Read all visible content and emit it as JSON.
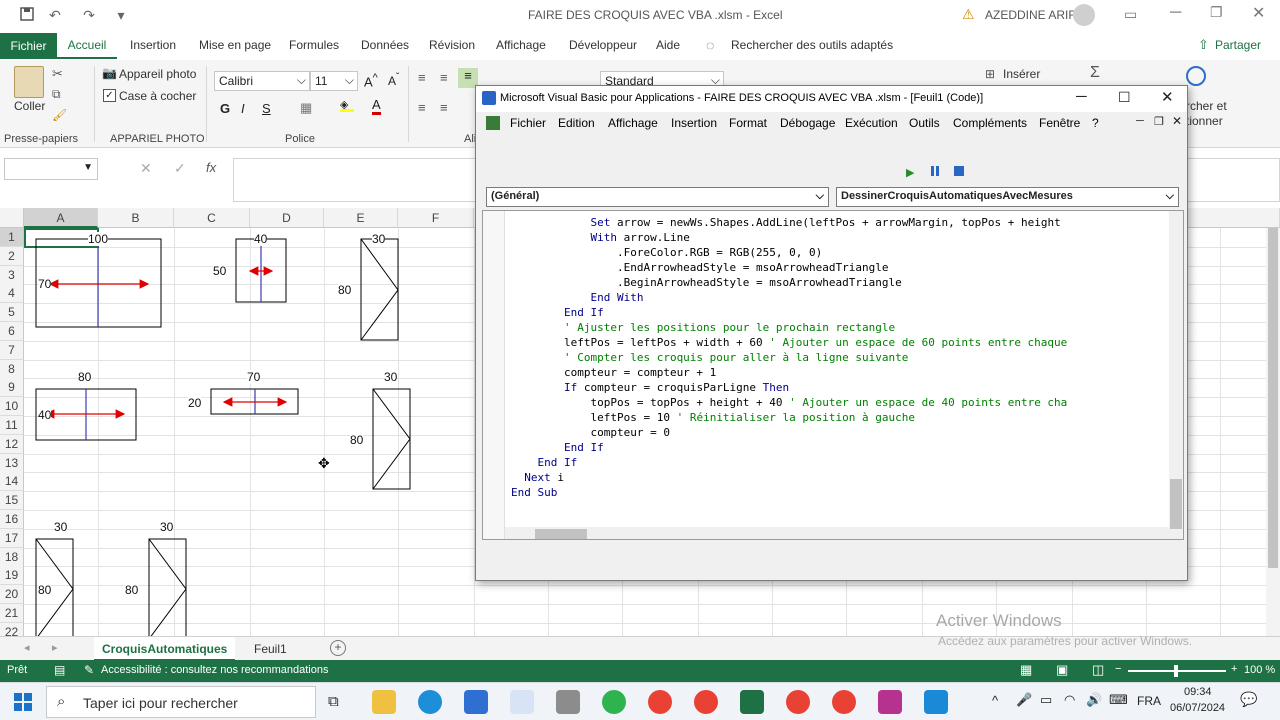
{
  "window": {
    "title": "FAIRE DES CROQUIS AVEC VBA .xlsm  -  Excel",
    "user": "AZEDDINE ARIF"
  },
  "tabs": [
    "Fichier",
    "Accueil",
    "Insertion",
    "Mise en page",
    "Formules",
    "Données",
    "Révision",
    "Affichage",
    "Développeur",
    "Aide"
  ],
  "search_tools": "Rechercher des outils adaptés",
  "share": "Partager",
  "ribbon": {
    "paste": "Coller",
    "clipboard_label": "Presse-papiers",
    "camera": "Appareil photo",
    "checkbox": "Case à cocher",
    "camera_group": "APPARIEL PHOTO",
    "font_name": "Calibri",
    "font_size": "11",
    "font_group": "Police",
    "align_group": "Ali",
    "number_format": "Standard",
    "insert": "Insérer",
    "find_line1": "rcher et",
    "find_line2": "tionner",
    "bold": "G",
    "italic": "I",
    "underline": "S"
  },
  "formula": {
    "fx": "fx"
  },
  "columns": [
    "A",
    "B",
    "C",
    "D",
    "E",
    "F"
  ],
  "rows": [
    "1",
    "2",
    "3",
    "4",
    "5",
    "6",
    "7",
    "8",
    "9",
    "10",
    "11",
    "12",
    "13",
    "14",
    "15",
    "16",
    "17",
    "18",
    "19",
    "20",
    "21",
    "22"
  ],
  "sketch_labels": {
    "r1_w": "100",
    "r1_h": "70",
    "r2_w": "40",
    "r2_h": "50",
    "r3_w": "30",
    "r3_h": "80",
    "r4_w": "80",
    "r4_h": "40",
    "r5_w": "70",
    "r5_h": "20",
    "r6_w": "30",
    "r6_h": "80",
    "r7_w": "30",
    "r7_h": "80",
    "r8_w": "30",
    "r8_h": "80"
  },
  "sheets": {
    "active": "CroquisAutomatiques",
    "other": "Feuil1"
  },
  "status": {
    "ready": "Prêt",
    "accessibility": "Accessibilité : consultez nos recommandations",
    "zoom": "100 %"
  },
  "taskbar": {
    "search": "Taper ici pour rechercher",
    "lang": "FRA",
    "time": "09:34",
    "date": "06/07/2024"
  },
  "activate": {
    "title": "Activer Windows",
    "sub": "Accédez aux paramètres pour activer Windows."
  },
  "vbe": {
    "title": "Microsoft Visual Basic pour Applications - FAIRE DES CROQUIS AVEC VBA .xlsm - [Feuil1 (Code)]",
    "menu": [
      "Fichier",
      "Edition",
      "Affichage",
      "Insertion",
      "Format",
      "Débogage",
      "Exécution",
      "Outils",
      "Compléments",
      "Fenêtre",
      "?"
    ],
    "object_combo": "(Général)",
    "proc_combo": "DessinerCroquisAutomatiquesAvecMesures",
    "code_lines": [
      {
        "t": "            Set arrow = newWs.Shapes.AddLine(leftPos + arrowMargin, topPos + height",
        "c": ""
      },
      {
        "t": "            With arrow.Line",
        "c": ""
      },
      {
        "t": "                .ForeColor.RGB = RGB(255, 0, 0)",
        "c": ""
      },
      {
        "t": "                .EndArrowheadStyle = msoArrowheadTriangle",
        "c": ""
      },
      {
        "t": "                .BeginArrowheadStyle = msoArrowheadTriangle",
        "c": ""
      },
      {
        "t": "            End With",
        "c": ""
      },
      {
        "t": "        End If",
        "c": ""
      },
      {
        "t": "",
        "c": ""
      },
      {
        "t": "        ' Ajuster les positions pour le prochain rectangle",
        "c": "cm"
      },
      {
        "t": "        leftPos = leftPos + width + 60 ' Ajouter un espace de 60 points entre chaque",
        "c": "mix60"
      },
      {
        "t": "",
        "c": ""
      },
      {
        "t": "        ' Compter les croquis pour aller à la ligne suivante",
        "c": "cm"
      },
      {
        "t": "        compteur = compteur + 1",
        "c": ""
      },
      {
        "t": "        If compteur = croquisParLigne Then",
        "c": ""
      },
      {
        "t": "            topPos = topPos + height + 40 ' Ajouter un espace de 40 points entre cha",
        "c": "mix40"
      },
      {
        "t": "            leftPos = 10 ' Réinitialiser la position à gauche",
        "c": "mix10"
      },
      {
        "t": "            compteur = 0",
        "c": ""
      },
      {
        "t": "        End If",
        "c": ""
      },
      {
        "t": "    End If",
        "c": ""
      },
      {
        "t": "  Next i",
        "c": ""
      },
      {
        "t": "End Sub",
        "c": ""
      }
    ]
  }
}
